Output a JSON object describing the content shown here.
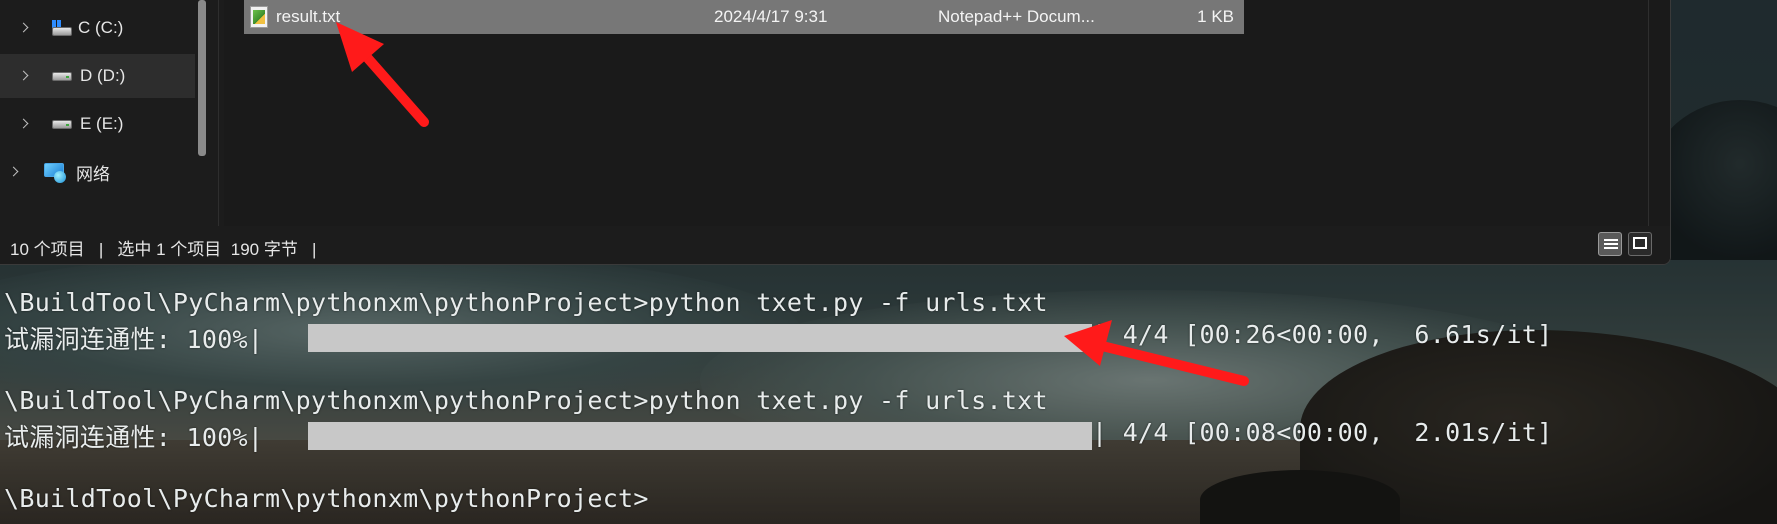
{
  "nav": {
    "items": [
      {
        "label": "C (C:)",
        "icon": "windows-drive-icon"
      },
      {
        "label": "D (D:)",
        "icon": "drive-icon",
        "selected": true
      },
      {
        "label": "E (E:)",
        "icon": "drive-icon"
      },
      {
        "label": "网络",
        "icon": "network-icon"
      }
    ]
  },
  "files": [
    {
      "name": "result.txt",
      "modified": "2024/4/17 9:31",
      "type": "Notepad++ Docum...",
      "size": "1 KB",
      "icon": "notepadpp-file-icon"
    }
  ],
  "status": {
    "item_count": "10 个项目",
    "selection": "选中 1 个项目  190 字节",
    "separator": "|"
  },
  "terminal": {
    "lines": [
      {
        "kind": "cmd",
        "text": "\\BuildTool\\PyCharm\\pythonxm\\pythonProject>python txet.py -f urls.txt"
      },
      {
        "kind": "progress",
        "label": "试漏洞连通性: 100%|",
        "progress": 1.0,
        "tail": "| 4/4 [00:26<00:00,  6.61s/it]"
      },
      {
        "kind": "blank",
        "text": ""
      },
      {
        "kind": "cmd",
        "text": "\\BuildTool\\PyCharm\\pythonxm\\pythonProject>python txet.py -f urls.txt"
      },
      {
        "kind": "progress",
        "label": "试漏洞连通性: 100%|",
        "progress": 1.0,
        "tail": "| 4/4 [00:08<00:00,  2.01s/it]"
      },
      {
        "kind": "blank",
        "text": ""
      },
      {
        "kind": "prompt",
        "text": "\\BuildTool\\PyCharm\\pythonxm\\pythonProject>"
      }
    ]
  },
  "colors": {
    "annotation_arrow": "#ff1a1a",
    "progress_bar": "#c8c8c8",
    "selected_row": "#777777"
  }
}
